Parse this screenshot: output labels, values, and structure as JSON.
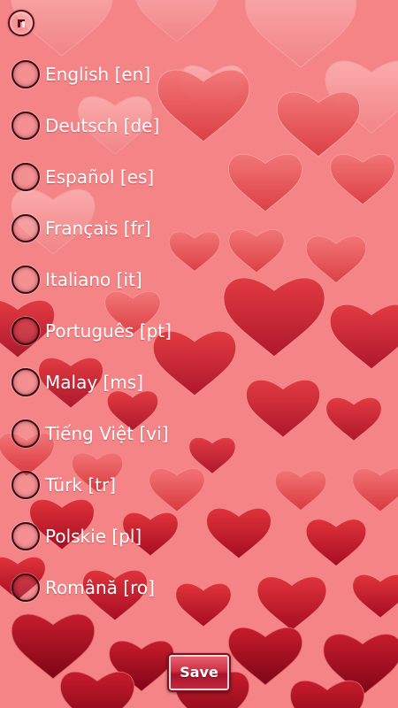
{
  "colors": {
    "background": "#f48486",
    "heart_light": "#f79ea0",
    "heart_mid": "#ec5a5e",
    "heart_dark": "#c0142a",
    "text": "#ffffff",
    "radio_border": "#3a0a12"
  },
  "header": {
    "back_icon": "back-icon"
  },
  "languages": [
    {
      "label": "English [en]"
    },
    {
      "label": "Deutsch [de]"
    },
    {
      "label": "Español [es]"
    },
    {
      "label": "Français [fr]"
    },
    {
      "label": "Italiano [it]"
    },
    {
      "label": "Português [pt]"
    },
    {
      "label": "Malay [ms]"
    },
    {
      "label": "Tiếng Việt [vi]"
    },
    {
      "label": "Türk [tr]"
    },
    {
      "label": "Polskie [pl]"
    },
    {
      "label": "Română [ro]"
    }
  ],
  "footer": {
    "save_label": "Save"
  }
}
